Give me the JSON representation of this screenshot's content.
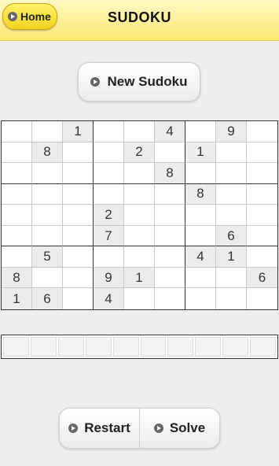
{
  "header": {
    "home_label": "Home",
    "title": "SUDOKU"
  },
  "new_button_label": "New Sudoku",
  "grid": [
    [
      "",
      "",
      "1",
      "",
      "",
      "4",
      "",
      "9",
      ""
    ],
    [
      "",
      "8",
      "",
      "",
      "2",
      "",
      "1",
      "",
      ""
    ],
    [
      "",
      "",
      "",
      "",
      "",
      "8",
      "",
      "",
      ""
    ],
    [
      "",
      "",
      "",
      "",
      "",
      "",
      "8",
      "",
      ""
    ],
    [
      "",
      "",
      "",
      "2",
      "",
      "",
      "",
      "",
      ""
    ],
    [
      "",
      "",
      "",
      "7",
      "",
      "",
      "",
      "6",
      ""
    ],
    [
      "",
      "5",
      "",
      "",
      "",
      "",
      "4",
      "1",
      ""
    ],
    [
      "8",
      "",
      "",
      "9",
      "1",
      "",
      "",
      "",
      "6"
    ],
    [
      "1",
      "6",
      "",
      "4",
      "",
      "",
      "",
      "",
      ""
    ]
  ],
  "actions": {
    "restart_label": "Restart",
    "solve_label": "Solve"
  },
  "colors": {
    "header_yellow": "#fde774",
    "given_cell": "#ececec"
  }
}
